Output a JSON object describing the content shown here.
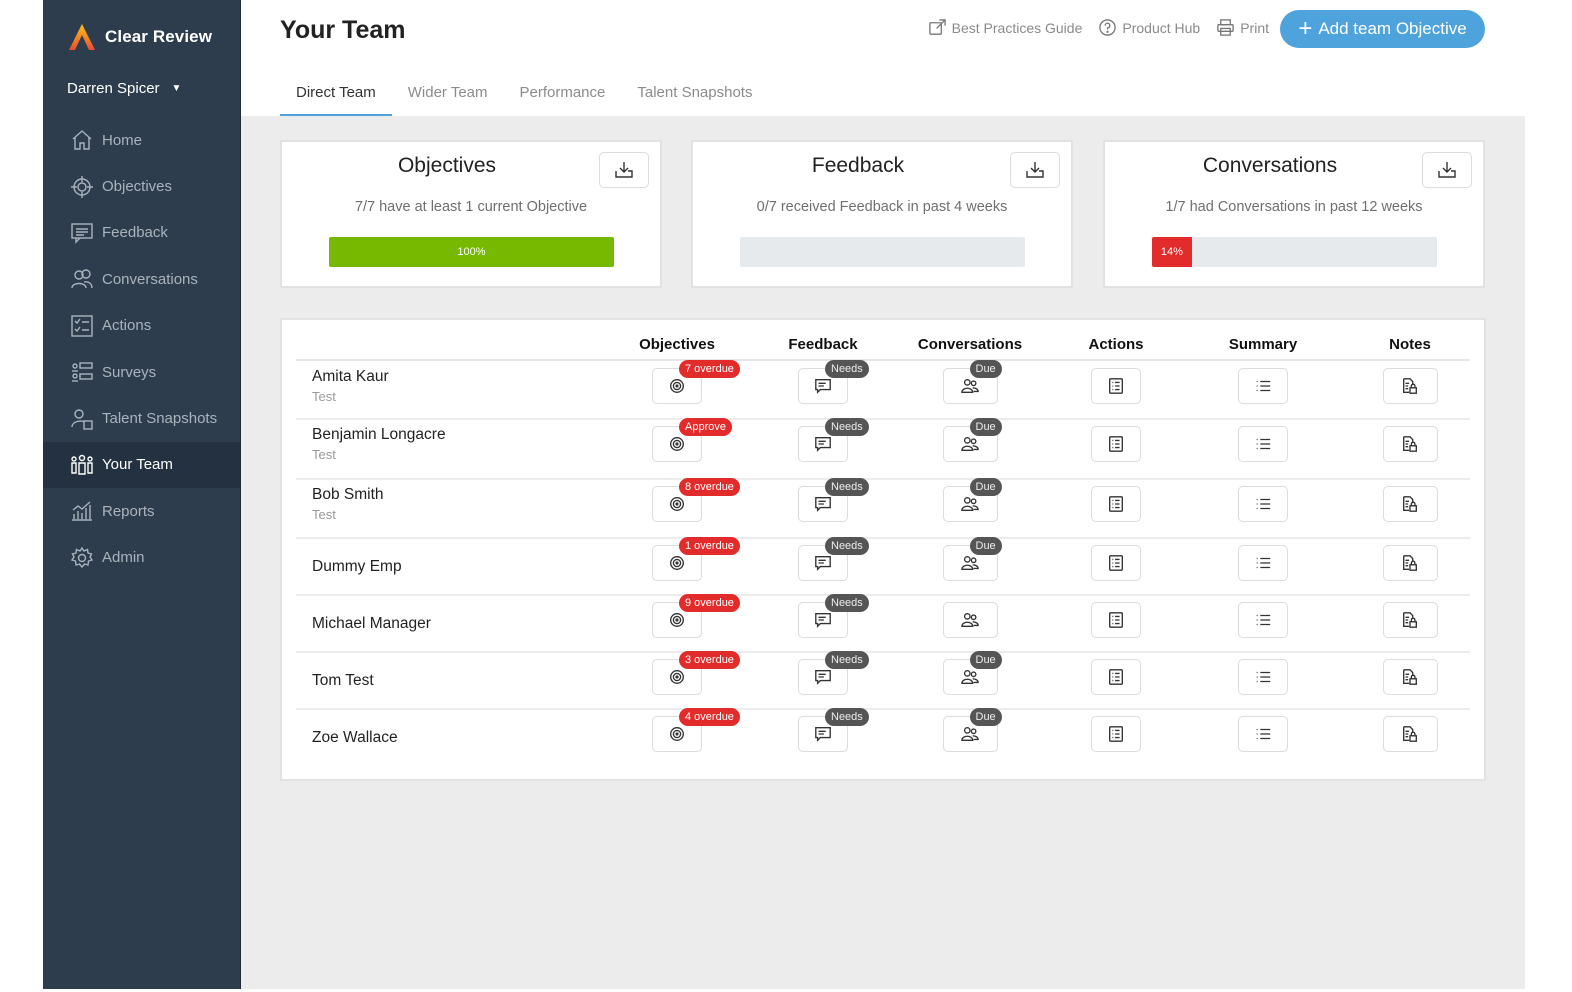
{
  "brand": {
    "name": "Clear Review"
  },
  "user": {
    "name": "Darren Spicer"
  },
  "sidebar": {
    "items": [
      {
        "label": "Home",
        "icon": "home-icon",
        "active": false
      },
      {
        "label": "Objectives",
        "icon": "target-icon",
        "active": false
      },
      {
        "label": "Feedback",
        "icon": "feedback-icon",
        "active": false
      },
      {
        "label": "Conversations",
        "icon": "conversations-icon",
        "active": false
      },
      {
        "label": "Actions",
        "icon": "checklist-icon",
        "active": false
      },
      {
        "label": "Surveys",
        "icon": "surveys-icon",
        "active": false
      },
      {
        "label": "Talent Snapshots",
        "icon": "talent-snapshot-icon",
        "active": false
      },
      {
        "label": "Your Team",
        "icon": "team-icon",
        "active": true
      },
      {
        "label": "Reports",
        "icon": "reports-icon",
        "active": false
      },
      {
        "label": "Admin",
        "icon": "gear-icon",
        "active": false
      }
    ]
  },
  "header": {
    "title": "Your Team",
    "links": [
      {
        "label": "Best Practices Guide",
        "icon": "external-link-icon"
      },
      {
        "label": "Product Hub",
        "icon": "help-icon"
      },
      {
        "label": "Print",
        "icon": "printer-icon"
      }
    ],
    "add_button": "Add team Objective",
    "accent": "#4fa3dc"
  },
  "tabs": [
    {
      "label": "Direct Team",
      "active": true
    },
    {
      "label": "Wider Team",
      "active": false
    },
    {
      "label": "Performance",
      "active": false
    },
    {
      "label": "Talent Snapshots",
      "active": false
    }
  ],
  "cards": [
    {
      "title": "Objectives",
      "subtitle": "7/7 have at least 1 current Objective",
      "percent": 100,
      "label": "100%",
      "color": "#76b900"
    },
    {
      "title": "Feedback",
      "subtitle": "0/7 received Feedback in past 4 weeks",
      "percent": 0,
      "label": "",
      "color": "#76b900"
    },
    {
      "title": "Conversations",
      "subtitle": "1/7 had Conversations in past 12 weeks",
      "percent": 14,
      "label": "14%",
      "color": "#e22c2c"
    }
  ],
  "table": {
    "columns": [
      "Objectives",
      "Feedback",
      "Conversations",
      "Actions",
      "Summary",
      "Notes"
    ],
    "rows": [
      {
        "name": "Amita Kaur",
        "role": "Test",
        "objectives_badge": "7 overdue",
        "feedback_badge": "Needs",
        "conversations_badge": "Due"
      },
      {
        "name": "Benjamin Longacre",
        "role": "Test",
        "objectives_badge": "Approve",
        "feedback_badge": "Needs",
        "conversations_badge": "Due"
      },
      {
        "name": "Bob Smith",
        "role": "Test",
        "objectives_badge": "8 overdue",
        "feedback_badge": "Needs",
        "conversations_badge": "Due"
      },
      {
        "name": "Dummy Emp",
        "role": "",
        "objectives_badge": "1 overdue",
        "feedback_badge": "Needs",
        "conversations_badge": "Due"
      },
      {
        "name": "Michael Manager",
        "role": "",
        "objectives_badge": "9 overdue",
        "feedback_badge": "Needs",
        "conversations_badge": ""
      },
      {
        "name": "Tom Test",
        "role": "",
        "objectives_badge": "3 overdue",
        "feedback_badge": "Needs",
        "conversations_badge": "Due"
      },
      {
        "name": "Zoe Wallace",
        "role": "",
        "objectives_badge": "4 overdue",
        "feedback_badge": "Needs",
        "conversations_badge": "Due"
      }
    ]
  }
}
